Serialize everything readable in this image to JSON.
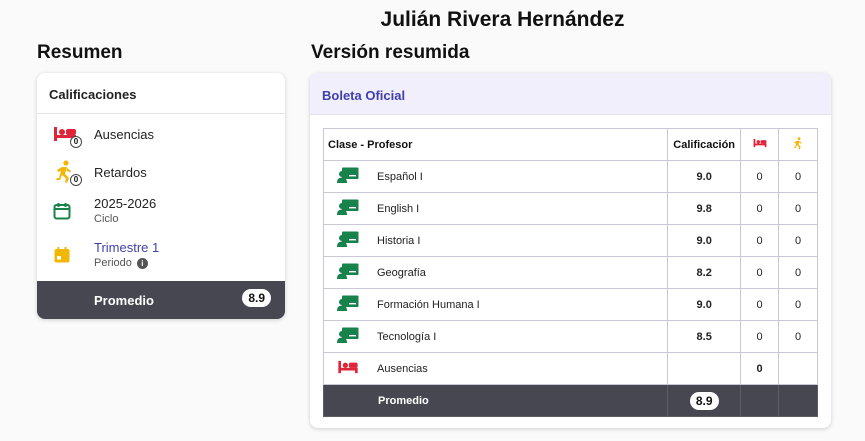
{
  "student_name": "Julián Rivera Hernández",
  "resumen": {
    "title": "Resumen",
    "card_title": "Calificaciones",
    "ausencias": {
      "label": "Ausencias",
      "count": "0"
    },
    "retardos": {
      "label": "Retardos",
      "count": "0"
    },
    "ciclo": {
      "value": "2025-2026",
      "label": "Ciclo"
    },
    "periodo": {
      "value": "Trimestre 1",
      "label": "Periodo"
    },
    "promedio": {
      "label": "Promedio",
      "value": "8.9"
    }
  },
  "version": {
    "title": "Versión resumida",
    "card_title": "Boleta Oficial",
    "headers": {
      "clase": "Clase - Profesor",
      "calificacion": "Calificación"
    },
    "rows": [
      {
        "clase": "Español I",
        "calificacion": "9.0",
        "ausencias": "0",
        "retardos": "0"
      },
      {
        "clase": "English I",
        "calificacion": "9.8",
        "ausencias": "0",
        "retardos": "0"
      },
      {
        "clase": "Historia I",
        "calificacion": "9.0",
        "ausencias": "0",
        "retardos": "0"
      },
      {
        "clase": "Geografía",
        "calificacion": "8.2",
        "ausencias": "0",
        "retardos": "0"
      },
      {
        "clase": "Formación Humana I",
        "calificacion": "9.0",
        "ausencias": "0",
        "retardos": "0"
      },
      {
        "clase": "Tecnología I",
        "calificacion": "8.5",
        "ausencias": "0",
        "retardos": "0"
      }
    ],
    "ausencias_row": {
      "label": "Ausencias",
      "value": "0"
    },
    "promedio_row": {
      "label": "Promedio",
      "value": "8.9"
    }
  },
  "colors": {
    "accent": "#3f3fae",
    "dark": "#474751",
    "red": "#e0243a",
    "yellow": "#f2b705",
    "green": "#17824a"
  },
  "icons": [
    "bed-icon",
    "running-person-icon",
    "calendar-icon",
    "info-icon",
    "teacher-board-icon"
  ]
}
